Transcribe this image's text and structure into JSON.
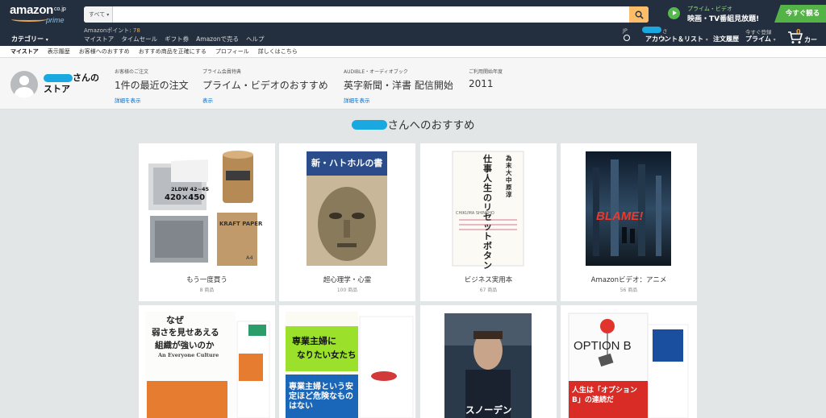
{
  "header": {
    "logo": {
      "word": "amazon",
      "tld": "co.jp",
      "sub": "prime"
    },
    "search": {
      "category": "すべて",
      "value": ""
    },
    "promo": {
      "line1": "プライム・ビデオ",
      "line2": "映画・TV番組見放題!",
      "cta": "今すぐ観る"
    },
    "category_menu": "カテゴリー",
    "points_label": "Amazonポイント:",
    "points_value": "78",
    "nav": [
      "マイストア",
      "タイムセール",
      "ギフト券",
      "Amazonで売る",
      "ヘルプ"
    ],
    "locale": "JP",
    "greeting_suffix": "さん",
    "account_list": "アカウント＆リスト",
    "orders": "注文履歴",
    "prime_top": "今すぐ登録",
    "prime": "プライム",
    "cart_count": "0",
    "cart": "カート"
  },
  "subnav": [
    "マイストア",
    "表示履歴",
    "お客様へのおすすめ",
    "おすすめ商品を正確にする",
    "プロフィール",
    "詳しくはこちら"
  ],
  "store": {
    "title_suffix": "さんの",
    "title_line2": "ストア",
    "columns": [
      {
        "label": "お客様のご注文",
        "value": "1件の最近の注文",
        "link": "詳細を表示"
      },
      {
        "label": "プライム会員特典",
        "value": "プライム・ビデオのおすすめ",
        "link": "表示"
      },
      {
        "label": "AUDIBLE・オーディオブック",
        "value": "英字新聞・洋書 配信開始",
        "link": "詳細を表示"
      },
      {
        "label": "ご利用開始年度",
        "value": "2011",
        "link": ""
      }
    ]
  },
  "recommendations": {
    "title_suffix": "さんへのおすすめ",
    "cards": [
      {
        "name": "もう一度買う",
        "count": "8 商品",
        "tag1": "2LDW 42~45",
        "tag2": "420×450",
        "tag3": "KRAFT PAPER",
        "tag4": "A4"
      },
      {
        "name": "超心理学・心霊",
        "count": "100 商品",
        "book_title": "新・ハトホルの書"
      },
      {
        "name": "ビジネス実用本",
        "count": "67 商品",
        "book_title": "仕事人生のリセットボタン",
        "authors": "為末大 中原淳",
        "publisher": "CHIKUMA SHINSHO"
      },
      {
        "name": "Amazonビデオ：アニメ",
        "count": "56 商品",
        "film": "BLAME!"
      },
      {
        "name": "",
        "count": "",
        "book_title1": "なぜ",
        "book_title2": "弱さを見せあえる",
        "book_title3": "組織が強いのか",
        "english": "An Everyone Culture"
      },
      {
        "name": "",
        "count": "",
        "book_title1": "専業主婦に",
        "book_title2": "なりたい女たち",
        "band": "専業主婦という安定ほど危険なものはない"
      },
      {
        "name": "",
        "count": "",
        "film": "スノーデン"
      },
      {
        "name": "",
        "count": "",
        "book_title": "OPTION B",
        "band": "人生は「オプションB」の連続だ"
      }
    ]
  },
  "colors": {
    "header": "#232f3e",
    "accent_orange": "#febd69",
    "link": "#0066c0",
    "prime_green": "#54b347"
  }
}
